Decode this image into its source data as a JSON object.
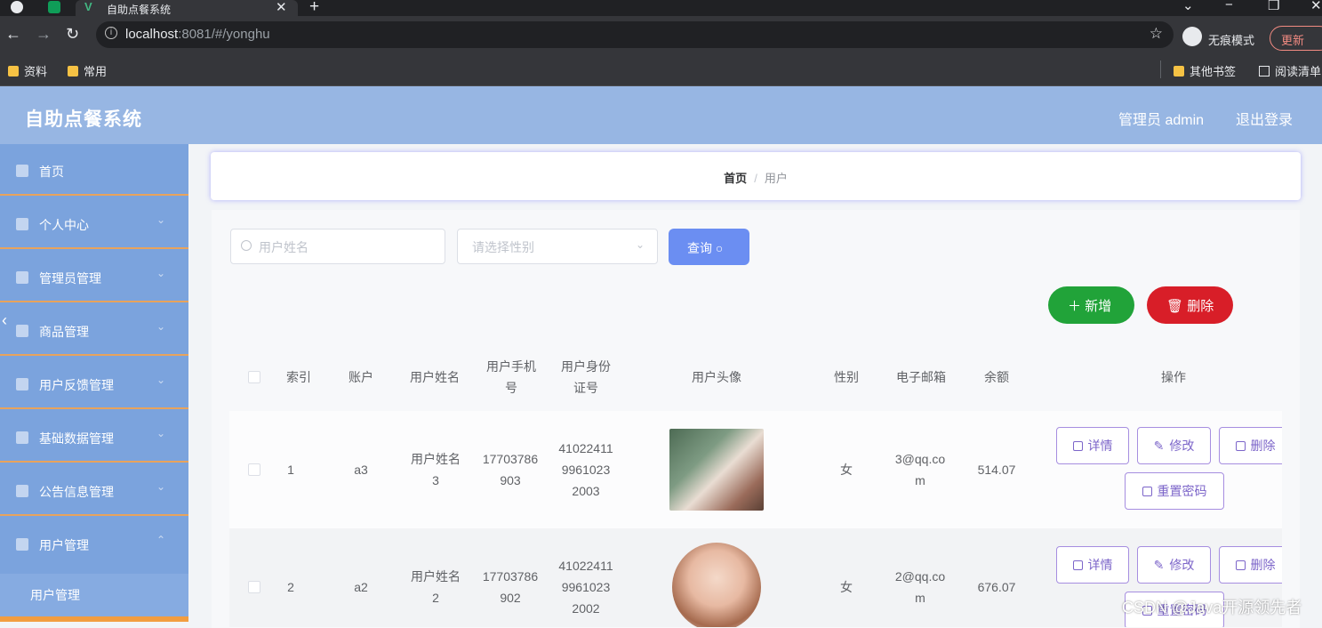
{
  "browser": {
    "tab_title": "自助点餐系统",
    "url_host": "localhost",
    "url_rest": ":8081/#/yonghu",
    "incognito_label": "无痕模式",
    "update_label": "更新",
    "bookmarks": [
      "资料",
      "常用"
    ],
    "other_bookmarks": "其他书签",
    "reading_list": "阅读清单"
  },
  "header": {
    "title": "自助点餐系统",
    "user": "管理员 admin",
    "logout": "退出登录"
  },
  "sidebar": {
    "items": [
      {
        "label": "首页"
      },
      {
        "label": "个人中心"
      },
      {
        "label": "管理员管理"
      },
      {
        "label": "商品管理"
      },
      {
        "label": "用户反馈管理"
      },
      {
        "label": "基础数据管理"
      },
      {
        "label": "公告信息管理"
      },
      {
        "label": "用户管理"
      }
    ],
    "active_sub": "用户管理"
  },
  "breadcrumb": {
    "home": "首页",
    "sep": "/",
    "current": "用户"
  },
  "search": {
    "name_placeholder": "用户姓名",
    "gender_placeholder": "请选择性别",
    "query_label": "查询"
  },
  "actions": {
    "add_label": "新增",
    "delete_label": "删除"
  },
  "table": {
    "columns": [
      "索引",
      "账户",
      "用户姓名",
      "用户手机号",
      "用户身份证号",
      "用户头像",
      "性别",
      "电子邮箱",
      "余额",
      "操作"
    ],
    "rows": [
      {
        "index": "1",
        "account": "a3",
        "name": "用户姓名3",
        "phone": "17703786903",
        "idcard": "410224119961023 2003",
        "gender": "女",
        "email": "3@qq.com",
        "balance": "514.07"
      },
      {
        "index": "2",
        "account": "a2",
        "name": "用户姓名2",
        "phone": "17703786902",
        "idcard": "410224119961023 2002",
        "gender": "女",
        "email": "2@qq.com",
        "balance": "676.07"
      }
    ],
    "row_actions": {
      "detail": "详情",
      "edit": "修改",
      "delete": "删除",
      "reset": "重置密码"
    }
  },
  "watermark": "CSDN @Java开源领先者"
}
